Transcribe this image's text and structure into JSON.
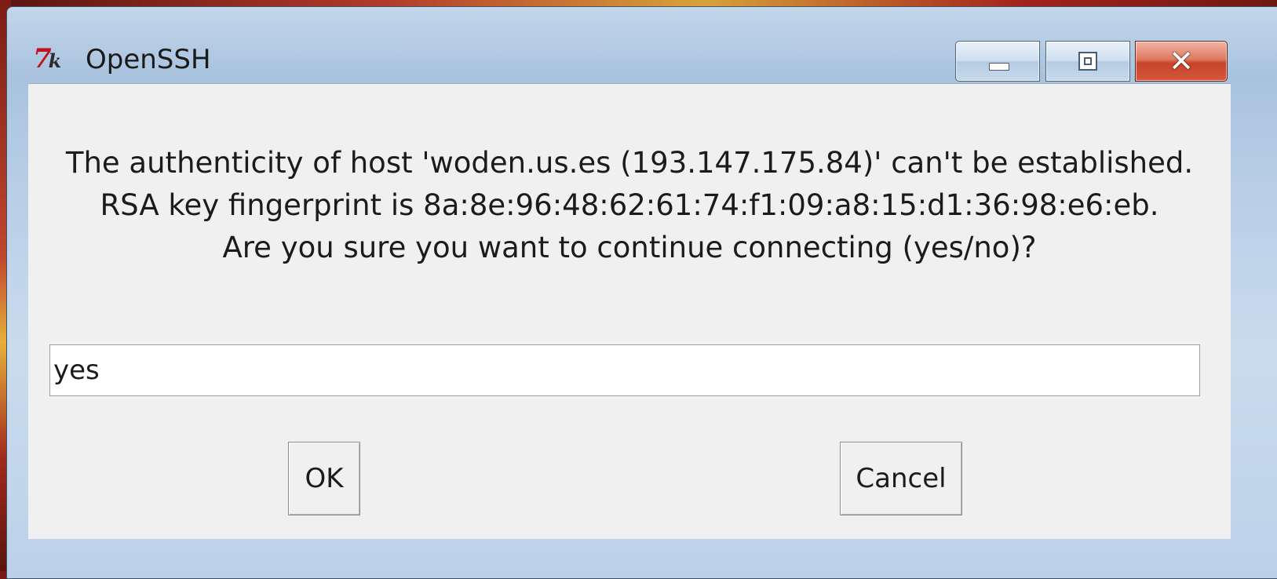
{
  "window": {
    "title": "OpenSSH",
    "app_icon": "tk-feather-icon"
  },
  "caption_buttons": {
    "minimize": "minimize-icon",
    "maximize": "maximize-icon",
    "close": "close-icon",
    "close_glyph": "✕"
  },
  "dialog": {
    "message_lines": [
      "The authenticity of host 'woden.us.es (193.147.175.84)' can't be established.",
      "RSA key fingerprint is 8a:8e:96:48:62:61:74:f1:09:a8:15:d1:36:98:e6:eb.",
      "Are you sure you want to continue connecting (yes/no)?"
    ],
    "input_value": "yes",
    "ok_label": "OK",
    "cancel_label": "Cancel"
  },
  "colors": {
    "close_button": "#c7432a",
    "client_background": "#f0f0f0",
    "title_bar": "#b7cde6"
  }
}
